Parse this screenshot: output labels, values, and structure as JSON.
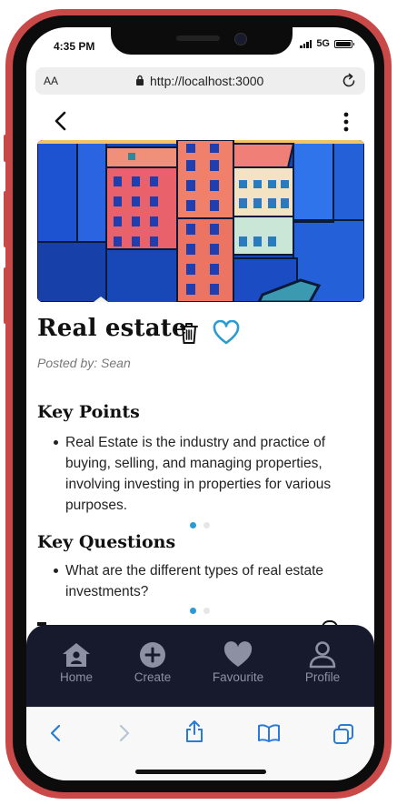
{
  "status_bar": {
    "time": "4:35 PM",
    "network": "5G"
  },
  "browser": {
    "text_size_label": "AA",
    "url": "http://localhost:3000"
  },
  "post": {
    "title": "Real estate",
    "posted_by": "Posted by: Sean",
    "hero_icon": "city-buildings-painting"
  },
  "sections": {
    "key_points": {
      "heading": "Key Points",
      "items": [
        "Real Estate is the industry and practice of buying, selling, and managing properties, involving investing in properties for various purposes."
      ],
      "carousel_active_index": 0,
      "carousel_count": 2
    },
    "key_questions": {
      "heading": "Key Questions",
      "items": [
        "What are the different types of real estate investments?"
      ],
      "carousel_active_index": 0,
      "carousel_count": 2
    }
  },
  "tab_bar": {
    "tabs": [
      {
        "label": "Home",
        "icon": "home-icon"
      },
      {
        "label": "Create",
        "icon": "plus-circle-icon"
      },
      {
        "label": "Favourite",
        "icon": "heart-icon"
      },
      {
        "label": "Profile",
        "icon": "profile-icon"
      }
    ]
  },
  "colors": {
    "accent": "#2b9bd4",
    "tab_bar_bg": "#171a2c",
    "tab_inactive": "#8d90a2",
    "phone_frame": "#c94848"
  }
}
